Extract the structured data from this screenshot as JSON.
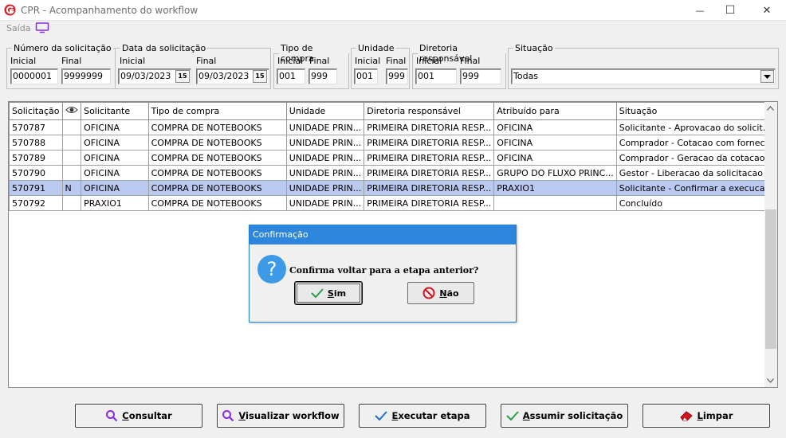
{
  "window": {
    "title": "CPR - Acompanhamento do workflow",
    "minimize": "—",
    "maximize": "☐",
    "close": "✕"
  },
  "menu": {
    "saida": "Saída"
  },
  "filters": {
    "numero": {
      "legend": "Número da solicitação",
      "inicial_label": "Inicial",
      "final_label": "Final",
      "inicial": "0000001",
      "final": "9999999"
    },
    "data": {
      "legend": "Data da solicitação",
      "inicial_label": "Inicial",
      "final_label": "Final",
      "inicial": "09/03/2023",
      "final": "09/03/2023",
      "cal_label": "15"
    },
    "tipo": {
      "legend": "Tipo de compra",
      "inicial_label": "Inicial",
      "final_label": "Final",
      "inicial": "001",
      "final": "999"
    },
    "unidade": {
      "legend": "Unidade",
      "inicial_label": "Inicial",
      "final_label": "Final",
      "inicial": "001",
      "final": "999"
    },
    "diretoria": {
      "legend": "Diretoria responsável",
      "inicial_label": "Inicial",
      "final_label": "Final",
      "inicial": "001",
      "final": "999"
    },
    "situacao": {
      "legend": "Situação",
      "value": "Todas"
    }
  },
  "grid": {
    "columns": [
      "Solicitação",
      "",
      "Solicitante",
      "Tipo de compra",
      "Unidade",
      "Diretoria responsável",
      "Atribuído para",
      "Situação"
    ],
    "rows": [
      [
        "570787",
        "",
        "OFICINA",
        "COMPRA DE NOTEBOOKS",
        "UNIDADE PRIN...",
        "PRIMEIRA DIRETORIA RESP...",
        "OFICINA",
        "Solicitante - Aprovacao do solicit..."
      ],
      [
        "570788",
        "",
        "OFICINA",
        "COMPRA DE NOTEBOOKS",
        "UNIDADE PRIN...",
        "PRIMEIRA DIRETORIA RESP...",
        "OFICINA",
        "Comprador - Cotacao com fornec..."
      ],
      [
        "570789",
        "",
        "OFICINA",
        "COMPRA DE NOTEBOOKS",
        "UNIDADE PRIN...",
        "PRIMEIRA DIRETORIA RESP...",
        "OFICINA",
        "Comprador - Geracao da cotacao"
      ],
      [
        "570790",
        "",
        "OFICINA",
        "COMPRA DE NOTEBOOKS",
        "UNIDADE PRIN...",
        "PRIMEIRA DIRETORIA RESP...",
        "GRUPO DO FLUXO PRINC...",
        "Gestor - Liberacao da solicitacao ..."
      ],
      [
        "570791",
        "N",
        "OFICINA",
        "COMPRA DE NOTEBOOKS",
        "UNIDADE PRIN...",
        "PRIMEIRA DIRETORIA RESP...",
        "PRAXIO1",
        "Solicitante - Confirmar a execuca..."
      ],
      [
        "570792",
        "",
        "PRAXIO1",
        "COMPRA DE NOTEBOOKS",
        "UNIDADE PRIN...",
        "PRIMEIRA DIRETORIA RESP...",
        "",
        "Concluído"
      ]
    ],
    "selected_row": 4
  },
  "dialog": {
    "title": "Confirmação",
    "message": "Confirma voltar para a etapa anterior?",
    "yes": "Sim",
    "no": "Não"
  },
  "buttons": {
    "consultar": "Consultar",
    "visualizar": "Visualizar workflow",
    "executar": "Executar etapa",
    "assumir": "Assumir solicitação",
    "limpar": "Limpar"
  },
  "colors": {
    "selection": "#b9c9f0",
    "dialog_title": "#2e85dc",
    "logo_red": "#d21f26",
    "search_icon": "#8a2be2",
    "check_icon": "#2a9d4a",
    "execute_check": "#1e6fd0"
  }
}
